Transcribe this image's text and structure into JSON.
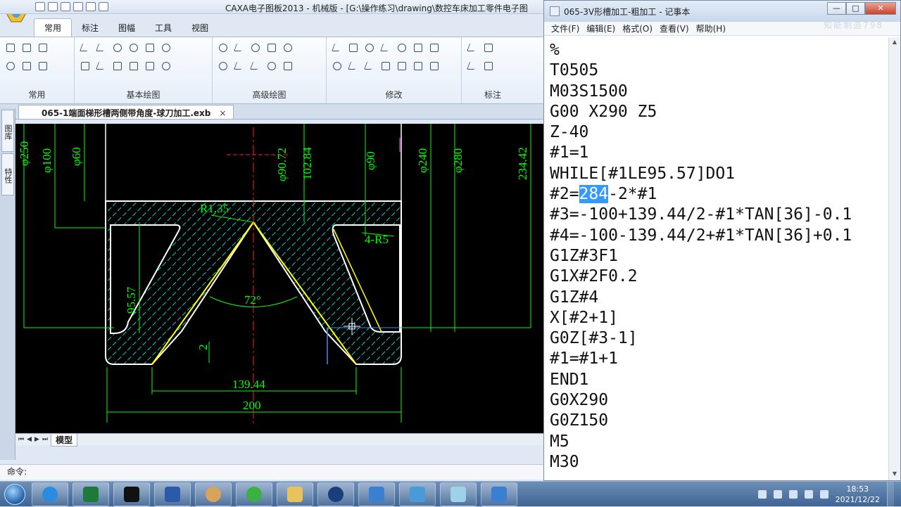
{
  "caxa": {
    "window_title": "CAXA电子图板2013 - 机械版 - [G:\\操作练习\\drawing\\数控车床加工零件电子图",
    "ribbon_tabs": [
      "常用",
      "标注",
      "图幅",
      "工具",
      "视图"
    ],
    "groups": [
      "常用",
      "基本绘图",
      "高级绘图",
      "修改",
      "标注"
    ],
    "doc_tab": "065-1端面梯形槽两侧带角度-球刀加工.exb",
    "doc_tab_close": "×",
    "side_tabs": [
      "图库",
      "特性"
    ],
    "model_tab": "模型",
    "nav_buttons": [
      "⏮",
      "◀",
      "▶",
      "⏭"
    ],
    "command_prompt": "命令:"
  },
  "drawing": {
    "dims": {
      "phi250": "φ250",
      "phi100": "φ100",
      "phi60": "φ60",
      "phi9072": "φ90.72",
      "d10284": "102.84",
      "phi90": "φ90",
      "phi240": "φ240",
      "phi280": "φ280",
      "d23442": "234.42",
      "r135": "R1.35",
      "r5": "4-R5",
      "d9557": "95.57",
      "ang": "72°",
      "d2": "2",
      "d13944": "139.44",
      "d200": "200"
    },
    "colors": {
      "background": "#000000",
      "dimension": "#00ff00",
      "centerline": "#ff2020",
      "hatch": "#00ffff",
      "outline": "#ffffff",
      "toolpath": "#ffff00"
    }
  },
  "notepad": {
    "title": "065-3V形槽加工-粗加工 - 记事本",
    "menus": [
      "文件(F)",
      "编辑(E)",
      "格式(O)",
      "查看(V)",
      "帮助(H)"
    ],
    "watermark": "知能制造798",
    "lines_before_sel": [
      "%",
      "T0505",
      "M03S1500",
      "G00 X290 Z5",
      "Z-40",
      "#1=1",
      "WHILE[#1LE95.57]DO1"
    ],
    "sel_prefix": "#2=",
    "sel_text": "284",
    "sel_suffix": "-2*#1",
    "lines_after_sel": [
      "#3=-100+139.44/2-#1*TAN[36]-0.1",
      "#4=-100-139.44/2+#1*TAN[36]+0.1",
      "G1Z#3F1",
      "G1X#2F0.2",
      "G1Z#4",
      "X[#2+1]",
      "G0Z[#3-1]",
      "#1=#1+1",
      "END1",
      "G0X290",
      "G0Z150",
      "M5",
      "M30"
    ]
  },
  "taskbar": {
    "apps": [
      "ie-icon",
      "excel-icon",
      "capcut-icon",
      "word-icon",
      "paint-icon",
      "browser-icon",
      "folder-icon",
      "record-icon",
      "caxa-icon",
      "tool-icon",
      "notepad-icon",
      "caxa2-icon"
    ],
    "time": "18:53",
    "date": "2021/12/22"
  }
}
